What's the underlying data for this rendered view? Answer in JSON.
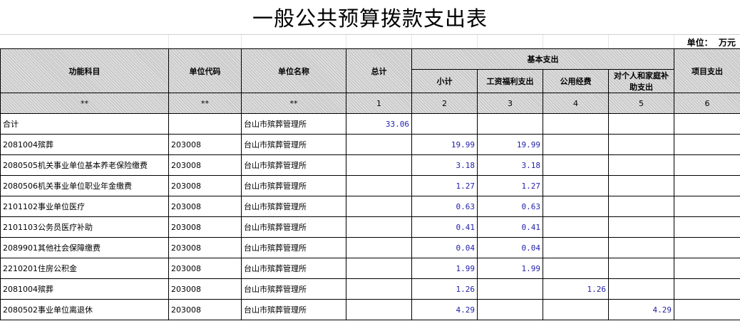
{
  "title": "一般公共预算拨款支出表",
  "unit_label": "单位：",
  "unit_value": "万元",
  "headers": {
    "function": "功能科目",
    "code": "单位代码",
    "name": "单位名称",
    "total": "总计",
    "basic": "基本支出",
    "subtotal": "小计",
    "wage": "工资福利支出",
    "public": "公用经费",
    "personal": "对个人和家庭补助支出",
    "project": "项目支出"
  },
  "index_row": [
    "**",
    "**",
    "**",
    "1",
    "2",
    "3",
    "4",
    "5",
    "6"
  ],
  "rows": [
    {
      "func": "合计",
      "code": "",
      "name": "台山市殡葬管理所",
      "total": "33.06",
      "subtotal": "",
      "wage": "",
      "public": "",
      "personal": "",
      "project": ""
    },
    {
      "func": "2081004殡葬",
      "code": "203008",
      "name": "台山市殡葬管理所",
      "total": "",
      "subtotal": "19.99",
      "wage": "19.99",
      "public": "",
      "personal": "",
      "project": ""
    },
    {
      "func": "2080505机关事业单位基本养老保险缴费",
      "code": "203008",
      "name": "台山市殡葬管理所",
      "total": "",
      "subtotal": "3.18",
      "wage": "3.18",
      "public": "",
      "personal": "",
      "project": ""
    },
    {
      "func": "2080506机关事业单位职业年金缴费",
      "code": "203008",
      "name": "台山市殡葬管理所",
      "total": "",
      "subtotal": "1.27",
      "wage": "1.27",
      "public": "",
      "personal": "",
      "project": ""
    },
    {
      "func": "2101102事业单位医疗",
      "code": "203008",
      "name": "台山市殡葬管理所",
      "total": "",
      "subtotal": "0.63",
      "wage": "0.63",
      "public": "",
      "personal": "",
      "project": ""
    },
    {
      "func": "2101103公务员医疗补助",
      "code": "203008",
      "name": "台山市殡葬管理所",
      "total": "",
      "subtotal": "0.41",
      "wage": "0.41",
      "public": "",
      "personal": "",
      "project": ""
    },
    {
      "func": "2089901其他社会保障缴费",
      "code": "203008",
      "name": "台山市殡葬管理所",
      "total": "",
      "subtotal": "0.04",
      "wage": "0.04",
      "public": "",
      "personal": "",
      "project": ""
    },
    {
      "func": "2210201住房公积金",
      "code": "203008",
      "name": "台山市殡葬管理所",
      "total": "",
      "subtotal": "1.99",
      "wage": "1.99",
      "public": "",
      "personal": "",
      "project": ""
    },
    {
      "func": "2081004殡葬",
      "code": "203008",
      "name": "台山市殡葬管理所",
      "total": "",
      "subtotal": "1.26",
      "wage": "",
      "public": "1.26",
      "personal": "",
      "project": ""
    },
    {
      "func": "2080502事业单位离退休",
      "code": "203008",
      "name": "台山市殡葬管理所",
      "total": "",
      "subtotal": "4.29",
      "wage": "",
      "public": "",
      "personal": "4.29",
      "project": ""
    }
  ]
}
